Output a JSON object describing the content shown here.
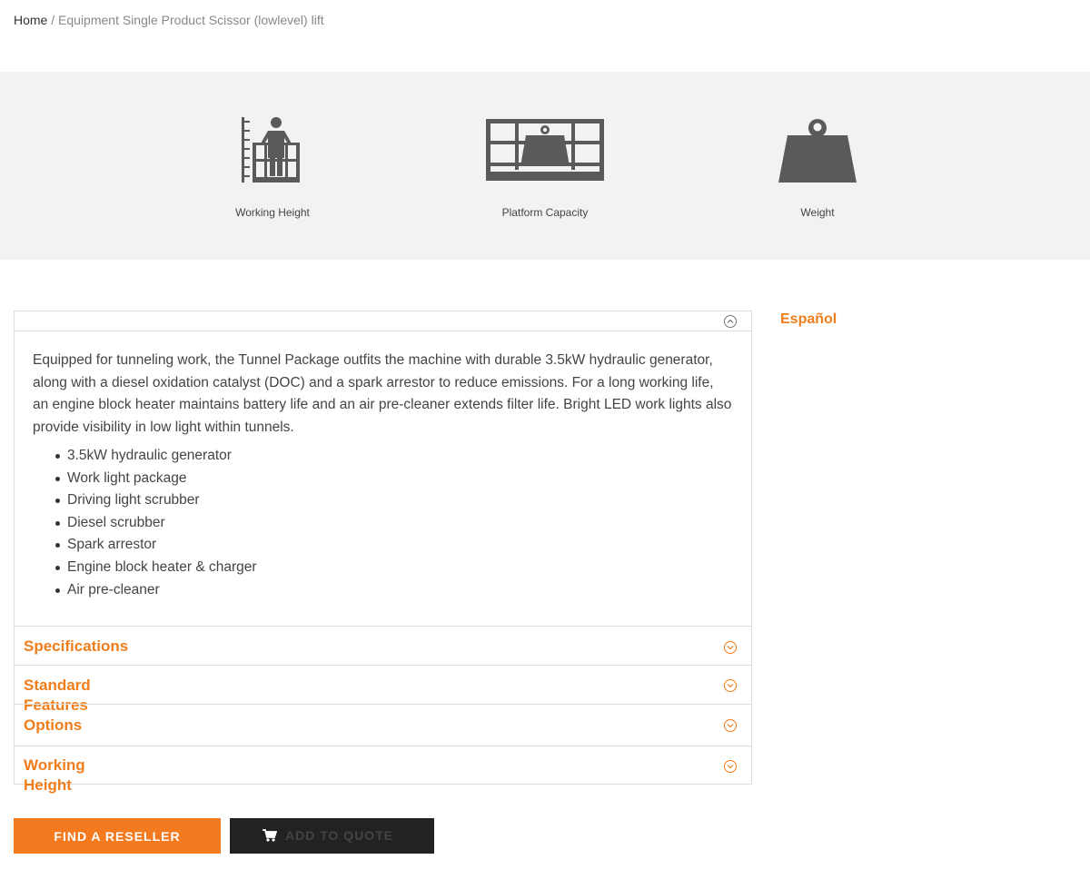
{
  "breadcrumb": {
    "home": "Home",
    "separator": "/",
    "current": "Equipment Single Product Scissor (lowlevel) lift"
  },
  "specs": [
    {
      "label": "Working Height",
      "icon": "working-height-icon"
    },
    {
      "label": "Platform Capacity",
      "icon": "platform-capacity-icon"
    },
    {
      "label": "Weight",
      "icon": "weight-icon"
    }
  ],
  "accordion": {
    "open_section": {
      "description": "Equipped for tunneling work, the Tunnel Package outfits the machine with durable 3.5kW hydraulic generator, along with a diesel oxidation catalyst (DOC) and a spark arrestor to reduce emissions. For a long working life, an engine block heater maintains battery life and an air pre-cleaner extends filter life. Bright LED work lights also provide visibility in low light within tunnels.",
      "features": [
        "3.5kW hydraulic generator",
        "Work light package",
        "Driving light scrubber",
        "Diesel scrubber",
        "Spark arrestor",
        "Engine block heater & charger",
        "Air pre-cleaner"
      ]
    },
    "sections": [
      {
        "title": "Specifications"
      },
      {
        "title": "Standard Features"
      },
      {
        "title": "Options"
      },
      {
        "title": "Working Height"
      }
    ]
  },
  "language_link": "Español",
  "buttons": {
    "find_reseller": "FIND A RESELLER",
    "add_to_quote": "ADD TO QUOTE"
  },
  "colors": {
    "accent": "#f47a20",
    "accent_text": "#f07d1a",
    "band_bg": "#f2f2f2",
    "icon_gray": "#5a5a5a",
    "dark_button": "#222222"
  }
}
